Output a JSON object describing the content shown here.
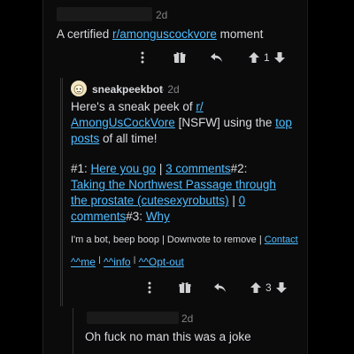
{
  "comment1": {
    "time": "2d",
    "text_before": "A certified ",
    "sub_link": "r/amonguscockvore",
    "text_after": " moment",
    "score": "1"
  },
  "bot": {
    "author": "sneakpeekbot",
    "time": "· 2d",
    "intro": "Here's a sneak peek of ",
    "sub_link_a": "r/",
    "sub_link_b": "AmongUsCockVore",
    "nsfw": " [NSFW] using the ",
    "top_posts_a": "top",
    "top_posts_b": "posts",
    "of_all_time": " of all time!",
    "p1_prefix": "#1: ",
    "p1_link": "Here you go",
    "sep": " | ",
    "p1_comments": "3 comments",
    "p2_prefix": "#2:",
    "p2_title_a": "Taking the Northwest Passage through",
    "p2_title_b": "the prostate (cutesexyrobutts)",
    "sep2": " | ",
    "p2_comments_a": "0",
    "p2_comments_b": "comments",
    "p3_prefix": "#3: ",
    "p3_link": "Why",
    "footer_text": "I'm a bot, beep boop | Downvote to remove | ",
    "contact": "Contact",
    "me": "^^me",
    "info": "^^info",
    "optout": "^^Opt-out",
    "score": "3"
  },
  "reply": {
    "time": "2d",
    "text": "Oh fuck no man this was a joke"
  },
  "icons": [
    "more-icon",
    "award-icon",
    "reply-icon",
    "upvote-icon",
    "downvote-icon"
  ],
  "colors": {
    "link": "#4fbcff",
    "background": "#0b0b0c",
    "text": "#d7dadc"
  }
}
